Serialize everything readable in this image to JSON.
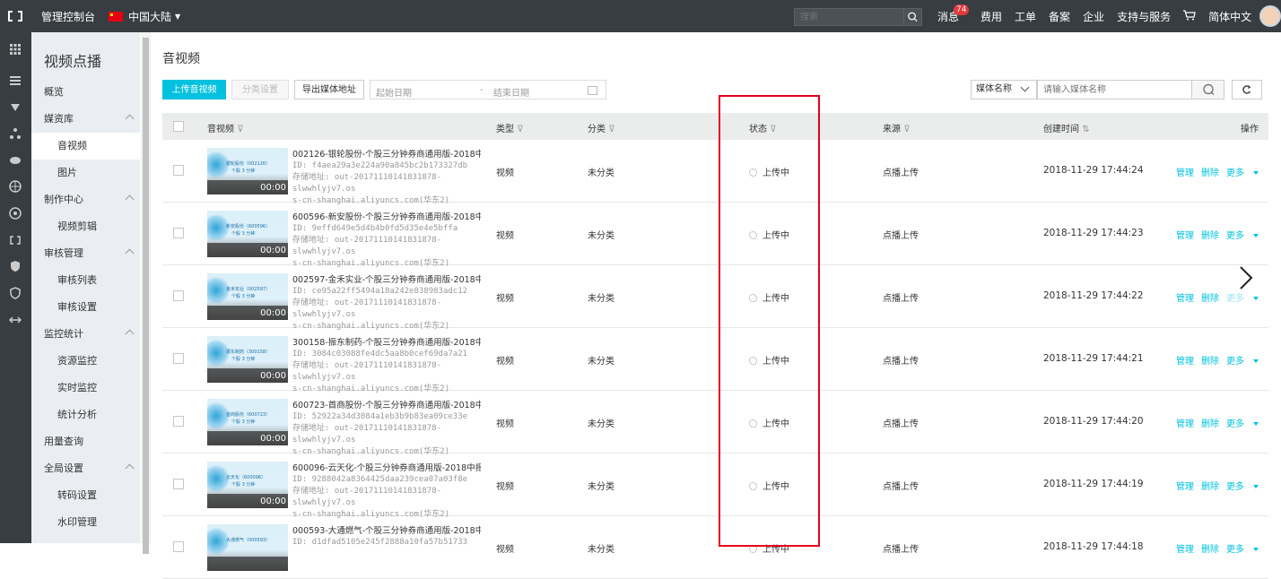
{
  "topbar": {
    "console": "管理控制台",
    "region": "中国大陆",
    "search_placeholder": "搜索",
    "messages": "消息",
    "messages_badge": "74",
    "fees": "费用",
    "tickets": "工单",
    "filing": "备案",
    "enterprise": "企业",
    "support": "支持与服务",
    "language": "简体中文"
  },
  "sidebar": {
    "title": "视频点播",
    "items": [
      {
        "label": "概览",
        "level": "group"
      },
      {
        "label": "媒资库",
        "level": "group",
        "expand": true
      },
      {
        "label": "音视频",
        "level": "sub",
        "active": true
      },
      {
        "label": "图片",
        "level": "sub"
      },
      {
        "label": "制作中心",
        "level": "group",
        "expand": true
      },
      {
        "label": "视频剪辑",
        "level": "sub"
      },
      {
        "label": "审核管理",
        "level": "group",
        "expand": true
      },
      {
        "label": "审核列表",
        "level": "sub"
      },
      {
        "label": "审核设置",
        "level": "sub"
      },
      {
        "label": "监控统计",
        "level": "group",
        "expand": true
      },
      {
        "label": "资源监控",
        "level": "sub"
      },
      {
        "label": "实时监控",
        "level": "sub"
      },
      {
        "label": "统计分析",
        "level": "sub"
      },
      {
        "label": "用量查询",
        "level": "group"
      },
      {
        "label": "全局设置",
        "level": "group",
        "expand": true
      },
      {
        "label": "转码设置",
        "level": "sub"
      },
      {
        "label": "水印管理",
        "level": "sub"
      }
    ]
  },
  "main": {
    "title": "音视频",
    "toolbar": {
      "upload": "上传音视频",
      "category": "分类设置",
      "export": "导出媒体地址",
      "start_date": "起始日期",
      "date_sep": "-",
      "end_date": "结束日期",
      "filter_select": "媒体名称",
      "filter_placeholder": "请输入媒体名称"
    },
    "columns": {
      "media": "音视频",
      "type": "类型",
      "category": "分类",
      "status": "状态",
      "source": "来源",
      "created": "创建时间",
      "ops": "操作"
    },
    "ops": {
      "manage": "管理",
      "delete": "删除",
      "more": "更多"
    },
    "rows": [
      {
        "title": "002126-银轮股份-个股三分钟券商通用版-2018中…",
        "id": "ID: f4aea29a3e224a90a845bc2b173327db",
        "path1": "存储地址: out-20171110141831878-slwwhlyjv7.os",
        "path2": "s-cn-shanghai.aliyuncs.com(华东2)",
        "thumb_name": "银轮股份（002126）",
        "thumb_sub": "个股 3 分钟",
        "duration": "00:00",
        "type": "视频",
        "category": "未分类",
        "status": "上传中",
        "source": "点播上传",
        "created": "2018-11-29 17:44:24"
      },
      {
        "title": "600596-新安股份-个股三分钟券商通用版-2018中…",
        "id": "ID: 9effd649e5d4b4b0fd5d35e4e5bffa",
        "path1": "存储地址: out-20171110141831878-slwwhlyjv7.os",
        "path2": "s-cn-shanghai.aliyuncs.com(华东2)",
        "thumb_name": "新安股份（600596）",
        "thumb_sub": "个股 3 分钟",
        "duration": "00:00",
        "type": "视频",
        "category": "未分类",
        "status": "上传中",
        "source": "点播上传",
        "created": "2018-11-29 17:44:23"
      },
      {
        "title": "002597-金禾实业-个股三分钟券商通用版-2018中…",
        "id": "ID: ce95a22ff5494a18a242e838983adc12",
        "path1": "存储地址: out-20171110141831878-slwwhlyjv7.os",
        "path2": "s-cn-shanghai.aliyuncs.com(华东2)",
        "thumb_name": "金禾实业（002597）",
        "thumb_sub": "个股 3 分钟",
        "duration": "00:00",
        "type": "视频",
        "category": "未分类",
        "status": "上传中",
        "source": "点播上传",
        "created": "2018-11-29 17:44:22",
        "more_dim": true
      },
      {
        "title": "300158-振东制药-个股三分钟券商通用版-2018中…",
        "id": "ID: 3084c03088fe4dc5aa8b0cef69da7a21",
        "path1": "存储地址: out-20171110141831878-slwwhlyjv7.os",
        "path2": "s-cn-shanghai.aliyuncs.com(华东2)",
        "thumb_name": "振东制药（300158）",
        "thumb_sub": "个股 3 分钟",
        "duration": "00:00",
        "type": "视频",
        "category": "未分类",
        "status": "上传中",
        "source": "点播上传",
        "created": "2018-11-29 17:44:21"
      },
      {
        "title": "600723-首商股份-个股三分钟券商通用版-2018中…",
        "id": "ID: 52922a34d3084a1eb3b9b83ea09ce33e",
        "path1": "存储地址: out-20171110141831878-slwwhlyjv7.os",
        "path2": "s-cn-shanghai.aliyuncs.com(华东2)",
        "thumb_name": "首商股份（600723）",
        "thumb_sub": "个股 3 分钟",
        "duration": "00:00",
        "type": "视频",
        "category": "未分类",
        "status": "上传中",
        "source": "点播上传",
        "created": "2018-11-29 17:44:20"
      },
      {
        "title": "600096-云天化-个股三分钟券商通用版-2018中报…",
        "id": "ID: 9288042a8364425daa239cea07a03f8e",
        "path1": "存储地址: out-20171110141831878-slwwhlyjv7.os",
        "path2": "s-cn-shanghai.aliyuncs.com(华东2)",
        "thumb_name": "云天化（600096）",
        "thumb_sub": "个股 3 分钟",
        "duration": "00:00",
        "type": "视频",
        "category": "未分类",
        "status": "上传中",
        "source": "点播上传",
        "created": "2018-11-29 17:44:19"
      },
      {
        "title": "000593-大通燃气-个股三分钟券商通用版-2018中…",
        "id": "ID: d1dfad5105e245f2888a10fa57b51733",
        "path1": "",
        "path2": "",
        "thumb_name": "大通燃气（000593）",
        "thumb_sub": "",
        "duration": "",
        "type": "视频",
        "category": "未分类",
        "status": "上传中",
        "source": "点播上传",
        "created": "2018-11-29 17:44:18"
      }
    ]
  }
}
